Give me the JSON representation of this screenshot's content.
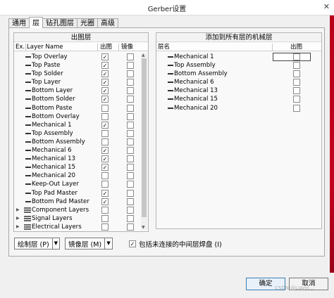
{
  "window": {
    "title": "Gerber设置",
    "close_glyph": "✕"
  },
  "tabs": [
    {
      "label": "通用",
      "active": false
    },
    {
      "label": "层",
      "active": true
    },
    {
      "label": "钻孔图层",
      "active": false
    },
    {
      "label": "光圈",
      "active": false
    },
    {
      "label": "高级",
      "active": false
    }
  ],
  "left_panel": {
    "title": "出图层",
    "headers": {
      "ex": "Ex...",
      "layer_name": "Layer Name",
      "plot": "出图",
      "mirror": "镜像"
    },
    "rows": [
      {
        "name": "Top Overlay",
        "plot": true,
        "mirror": false,
        "kind": "layer"
      },
      {
        "name": "Top Paste",
        "plot": true,
        "mirror": false,
        "kind": "layer"
      },
      {
        "name": "Top Solder",
        "plot": true,
        "mirror": false,
        "kind": "layer"
      },
      {
        "name": "Top Layer",
        "plot": true,
        "mirror": false,
        "kind": "layer"
      },
      {
        "name": "Bottom Layer",
        "plot": true,
        "mirror": false,
        "kind": "layer"
      },
      {
        "name": "Bottom Solder",
        "plot": true,
        "mirror": false,
        "kind": "layer"
      },
      {
        "name": "Bottom Paste",
        "plot": false,
        "mirror": false,
        "kind": "layer"
      },
      {
        "name": "Bottom Overlay",
        "plot": false,
        "mirror": false,
        "kind": "layer"
      },
      {
        "name": "Mechanical 1",
        "plot": true,
        "mirror": false,
        "kind": "layer"
      },
      {
        "name": "Top Assembly",
        "plot": false,
        "mirror": false,
        "kind": "layer"
      },
      {
        "name": "Bottom Assembly",
        "plot": false,
        "mirror": false,
        "kind": "layer"
      },
      {
        "name": "Mechanical 6",
        "plot": true,
        "mirror": false,
        "kind": "layer"
      },
      {
        "name": "Mechanical 13",
        "plot": true,
        "mirror": false,
        "kind": "layer"
      },
      {
        "name": "Mechanical 15",
        "plot": true,
        "mirror": false,
        "kind": "layer"
      },
      {
        "name": "Mechanical 20",
        "plot": false,
        "mirror": false,
        "kind": "layer"
      },
      {
        "name": "Keep-Out Layer",
        "plot": false,
        "mirror": false,
        "kind": "layer"
      },
      {
        "name": "Top Pad Master",
        "plot": true,
        "mirror": false,
        "kind": "layer"
      },
      {
        "name": "Bottom Pad Master",
        "plot": true,
        "mirror": false,
        "kind": "layer"
      },
      {
        "name": "Component Layers",
        "plot": false,
        "mirror": false,
        "kind": "group"
      },
      {
        "name": "Signal Layers",
        "plot": false,
        "mirror": false,
        "kind": "group"
      },
      {
        "name": "Electrical Layers",
        "plot": false,
        "mirror": false,
        "kind": "group"
      }
    ]
  },
  "right_panel": {
    "title": "添加到所有层的机械层",
    "headers": {
      "layer_name": "层名",
      "plot": "出图"
    },
    "rows": [
      {
        "name": "Mechanical 1",
        "plot": false
      },
      {
        "name": "Top Assembly",
        "plot": false
      },
      {
        "name": "Bottom Assembly",
        "plot": false
      },
      {
        "name": "Mechanical 6",
        "plot": false
      },
      {
        "name": "Mechanical 13",
        "plot": false
      },
      {
        "name": "Mechanical 15",
        "plot": false
      },
      {
        "name": "Mechanical 20",
        "plot": false
      }
    ]
  },
  "controls": {
    "plot_layers_button": "绘制层 (P)",
    "mirror_layers_button": "镜像层 (M)",
    "include_unconnected_label": "包括未连接的中间层焊盘 (I)",
    "include_unconnected_checked": true
  },
  "footer": {
    "ok": "确定",
    "cancel": "取消",
    "watermark": "CSDN @LIAnn..."
  }
}
